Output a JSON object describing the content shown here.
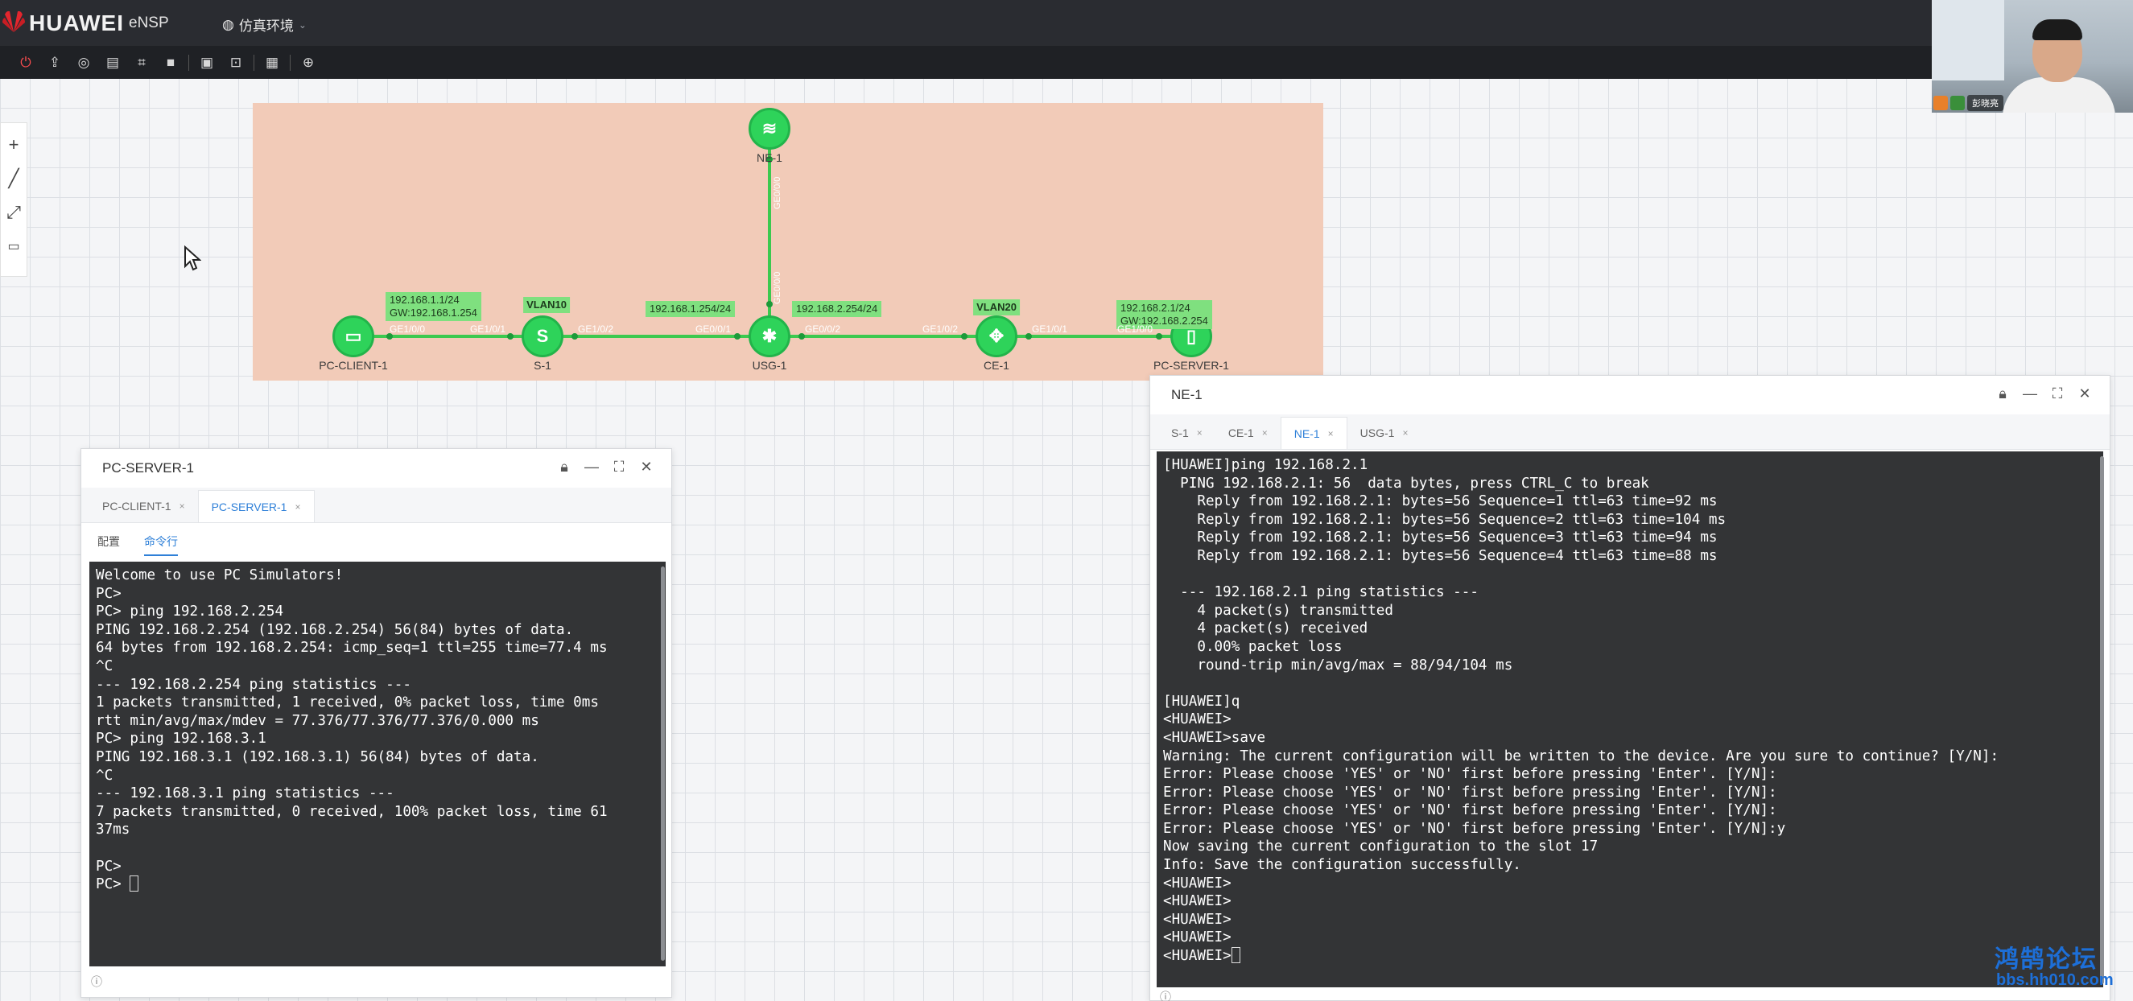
{
  "header": {
    "brand": "HUAWEI",
    "app_name": "eNSP",
    "env_label": "仿真环境"
  },
  "toolbar": {
    "icons": [
      "power-icon",
      "upload-icon",
      "hide-icon",
      "book-icon",
      "crop-icon",
      "square-icon",
      "image-icon",
      "briefcase-icon",
      "grid-icon",
      "globe-icon"
    ]
  },
  "left_tools": {
    "icons": [
      "add-icon",
      "line-icon",
      "fit-icon",
      "text-box-icon"
    ]
  },
  "webcam": {
    "name": "彭晓亮"
  },
  "topology": {
    "devices": [
      {
        "id": "ne1",
        "name": "NE-1",
        "glyph": "≋"
      },
      {
        "id": "pc",
        "name": "PC-CLIENT-1",
        "glyph": "▭"
      },
      {
        "id": "s1",
        "name": "S-1",
        "glyph": "S"
      },
      {
        "id": "usg",
        "name": "USG-1",
        "glyph": "✱"
      },
      {
        "id": "ce1",
        "name": "CE-1",
        "glyph": "✥"
      },
      {
        "id": "srv",
        "name": "PC-SERVER-1",
        "glyph": "▯"
      }
    ],
    "tags": {
      "pc_ip": "192.168.1.1/24",
      "pc_gw": "GW:192.168.1.254",
      "usg_left": "192.168.1.254/24",
      "usg_right": "192.168.2.254/24",
      "srv_ip": "192.168.2.1/24",
      "srv_gw": "GW:192.168.2.254",
      "vlan10": "VLAN10",
      "vlan20": "VLAN20"
    },
    "ports": {
      "pc_e": "GE1/0/0",
      "s1_w": "GE1/0/1",
      "s1_e": "GE1/0/2",
      "usg_w": "GE0/0/1",
      "usg_e": "GE0/0/2",
      "ce_w": "GE1/0/2",
      "ce_e": "GE1/0/1",
      "srv_w": "GE1/0/0",
      "ne_s": "GE0/0/0",
      "usg_n": "GE0/0/0"
    }
  },
  "left_window": {
    "title": "PC-SERVER-1",
    "tabs": [
      "PC-CLIENT-1",
      "PC-SERVER-1"
    ],
    "subtabs": [
      "配置",
      "命令行"
    ],
    "lines": [
      "Welcome to use PC Simulators!",
      "PC>",
      "PC> ping 192.168.2.254",
      "PING 192.168.2.254 (192.168.2.254) 56(84) bytes of data.",
      "64 bytes from 192.168.2.254: icmp_seq=1 ttl=255 time=77.4 ms",
      "^C",
      "--- 192.168.2.254 ping statistics ---",
      "1 packets transmitted, 1 received, 0% packet loss, time 0ms",
      "rtt min/avg/max/mdev = 77.376/77.376/77.376/0.000 ms",
      "PC> ping 192.168.3.1",
      "PING 192.168.3.1 (192.168.3.1) 56(84) bytes of data.",
      "^C",
      "--- 192.168.3.1 ping statistics ---",
      "7 packets transmitted, 0 received, 100% packet loss, time 61",
      "37ms",
      "",
      "PC>",
      "PC> "
    ]
  },
  "right_window": {
    "title": "NE-1",
    "tabs": [
      "S-1",
      "CE-1",
      "NE-1",
      "USG-1"
    ],
    "lines": [
      "[HUAWEI]ping 192.168.2.1",
      "  PING 192.168.2.1: 56  data bytes, press CTRL_C to break",
      "    Reply from 192.168.2.1: bytes=56 Sequence=1 ttl=63 time=92 ms",
      "    Reply from 192.168.2.1: bytes=56 Sequence=2 ttl=63 time=104 ms",
      "    Reply from 192.168.2.1: bytes=56 Sequence=3 ttl=63 time=94 ms",
      "    Reply from 192.168.2.1: bytes=56 Sequence=4 ttl=63 time=88 ms",
      "",
      "  --- 192.168.2.1 ping statistics ---",
      "    4 packet(s) transmitted",
      "    4 packet(s) received",
      "    0.00% packet loss",
      "    round-trip min/avg/max = 88/94/104 ms",
      "",
      "[HUAWEI]q",
      "<HUAWEI>",
      "<HUAWEI>save",
      "Warning: The current configuration will be written to the device. Are you sure to continue? [Y/N]:",
      "Error: Please choose 'YES' or 'NO' first before pressing 'Enter'. [Y/N]:",
      "Error: Please choose 'YES' or 'NO' first before pressing 'Enter'. [Y/N]:",
      "Error: Please choose 'YES' or 'NO' first before pressing 'Enter'. [Y/N]:",
      "Error: Please choose 'YES' or 'NO' first before pressing 'Enter'. [Y/N]:y",
      "Now saving the current configuration to the slot 17",
      "Info: Save the configuration successfully.",
      "<HUAWEI>",
      "<HUAWEI>",
      "<HUAWEI>",
      "<HUAWEI>",
      "<HUAWEI>"
    ]
  },
  "watermark": {
    "line1": "鸿鹄论坛",
    "line2": "bbs.hh010.com"
  },
  "colors": {
    "link": "#3cc94f",
    "device": "#2ed35a",
    "topo_bg": "#f2cbb8",
    "tab_active": "#2f80d8",
    "terminal_bg": "#333436"
  }
}
